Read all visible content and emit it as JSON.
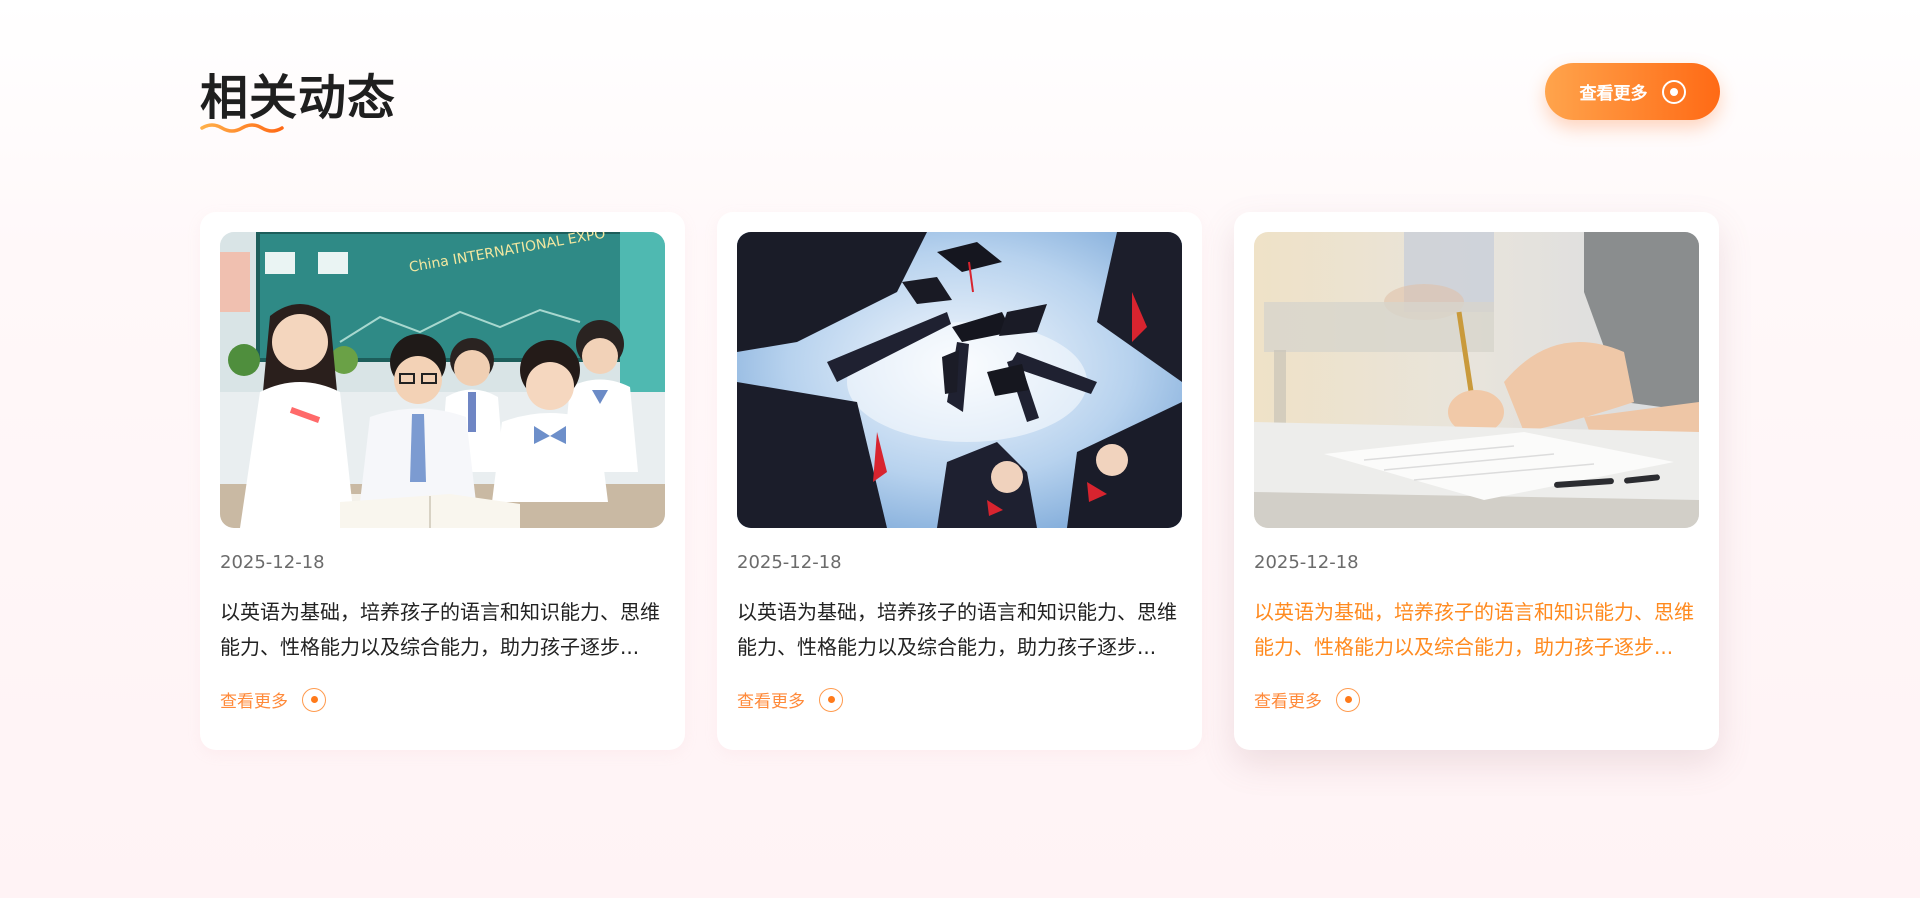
{
  "section": {
    "title": "相关动态",
    "more_label": "查看更多",
    "accent_color": "#ff7a1a"
  },
  "cards": [
    {
      "image_name": "classroom-students-photo",
      "date": "2025-12-18",
      "description": "以英语为基础，培养孩子的语言和知识能力、思维能力、性格能力以及综合能力，助力孩子逐步...",
      "more_label": "查看更多",
      "chalkboard_text": "China INTERNATIONAL EXPO"
    },
    {
      "image_name": "graduation-caps-photo",
      "date": "2025-12-18",
      "description": "以英语为基础，培养孩子的语言和知识能力、思维能力、性格能力以及综合能力，助力孩子逐步...",
      "more_label": "查看更多"
    },
    {
      "image_name": "exam-writing-photo",
      "date": "2025-12-18",
      "description": "以英语为基础，培养孩子的语言和知识能力、思维能力、性格能力以及综合能力，助力孩子逐步...",
      "more_label": "查看更多",
      "active": true
    }
  ]
}
